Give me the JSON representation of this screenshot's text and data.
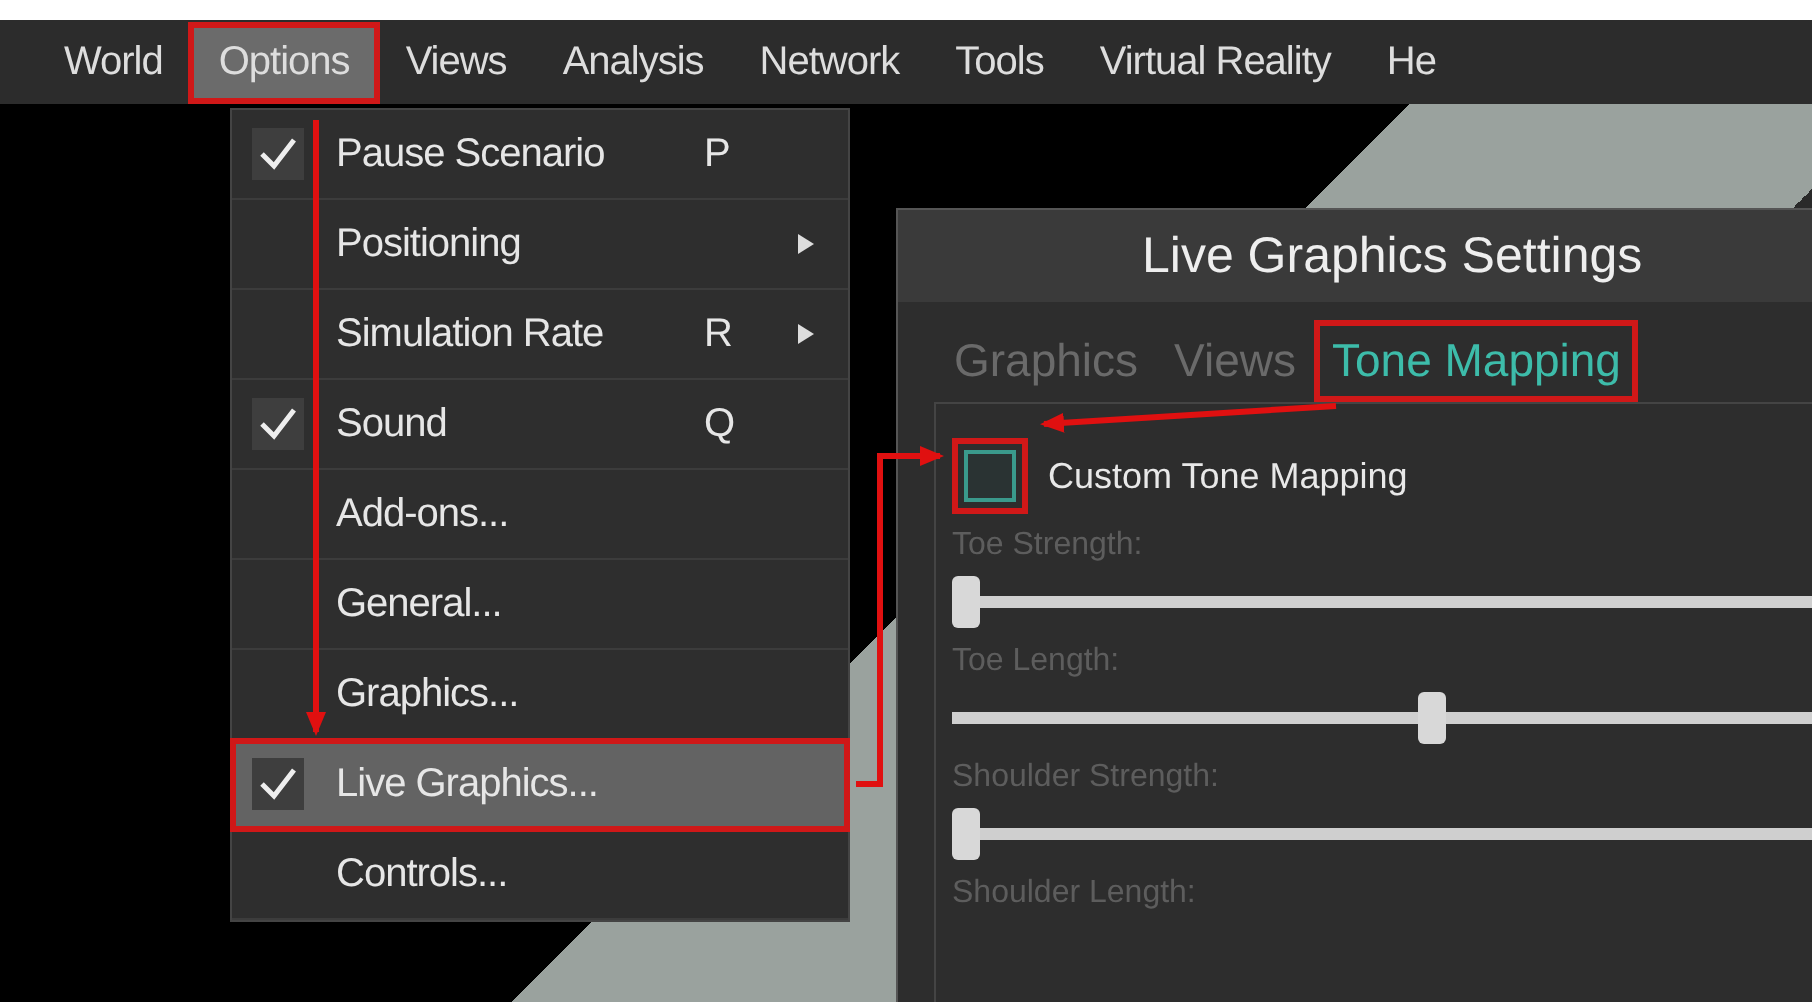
{
  "menu_bar": {
    "items": [
      {
        "label": "World",
        "selected": false,
        "highlighted": false
      },
      {
        "label": "Options",
        "selected": true,
        "highlighted": true
      },
      {
        "label": "Views",
        "selected": false,
        "highlighted": false
      },
      {
        "label": "Analysis",
        "selected": false,
        "highlighted": false
      },
      {
        "label": "Network",
        "selected": false,
        "highlighted": false
      },
      {
        "label": "Tools",
        "selected": false,
        "highlighted": false
      },
      {
        "label": "Virtual Reality",
        "selected": false,
        "highlighted": false
      },
      {
        "label": "He",
        "selected": false,
        "highlighted": false
      }
    ]
  },
  "options_menu": {
    "items": [
      {
        "label": "Pause Scenario",
        "shortcut": "P",
        "checked": true,
        "submenu": false,
        "selected": false
      },
      {
        "label": "Positioning",
        "checked": false,
        "submenu": true,
        "selected": false
      },
      {
        "label": "Simulation Rate",
        "shortcut": "R",
        "checked": false,
        "submenu": true,
        "selected": false
      },
      {
        "label": "Sound",
        "shortcut": "Q",
        "checked": true,
        "submenu": false,
        "selected": false
      },
      {
        "label": "Add-ons...",
        "checked": false,
        "submenu": false,
        "selected": false
      },
      {
        "label": "General...",
        "checked": false,
        "submenu": false,
        "selected": false
      },
      {
        "label": "Graphics...",
        "checked": false,
        "submenu": false,
        "selected": false
      },
      {
        "label": "Live Graphics...",
        "checked": true,
        "submenu": false,
        "selected": true
      },
      {
        "label": "Controls...",
        "checked": false,
        "submenu": false,
        "selected": false
      }
    ]
  },
  "dialog": {
    "title": "Live Graphics Settings",
    "tabs": [
      {
        "label": "Graphics",
        "selected": false,
        "highlighted": false
      },
      {
        "label": "Views",
        "selected": false,
        "highlighted": false
      },
      {
        "label": "Tone Mapping",
        "selected": true,
        "highlighted": true
      }
    ],
    "checkbox": {
      "label": "Custom Tone Mapping",
      "checked": false,
      "highlighted": true
    },
    "sliders": [
      {
        "label": "Toe Strength:",
        "level": 0
      },
      {
        "label": "Toe Length:",
        "level": 0.56
      },
      {
        "label": "Shoulder Strength:",
        "level": 0
      },
      {
        "label": "Shoulder Length:"
      }
    ]
  }
}
